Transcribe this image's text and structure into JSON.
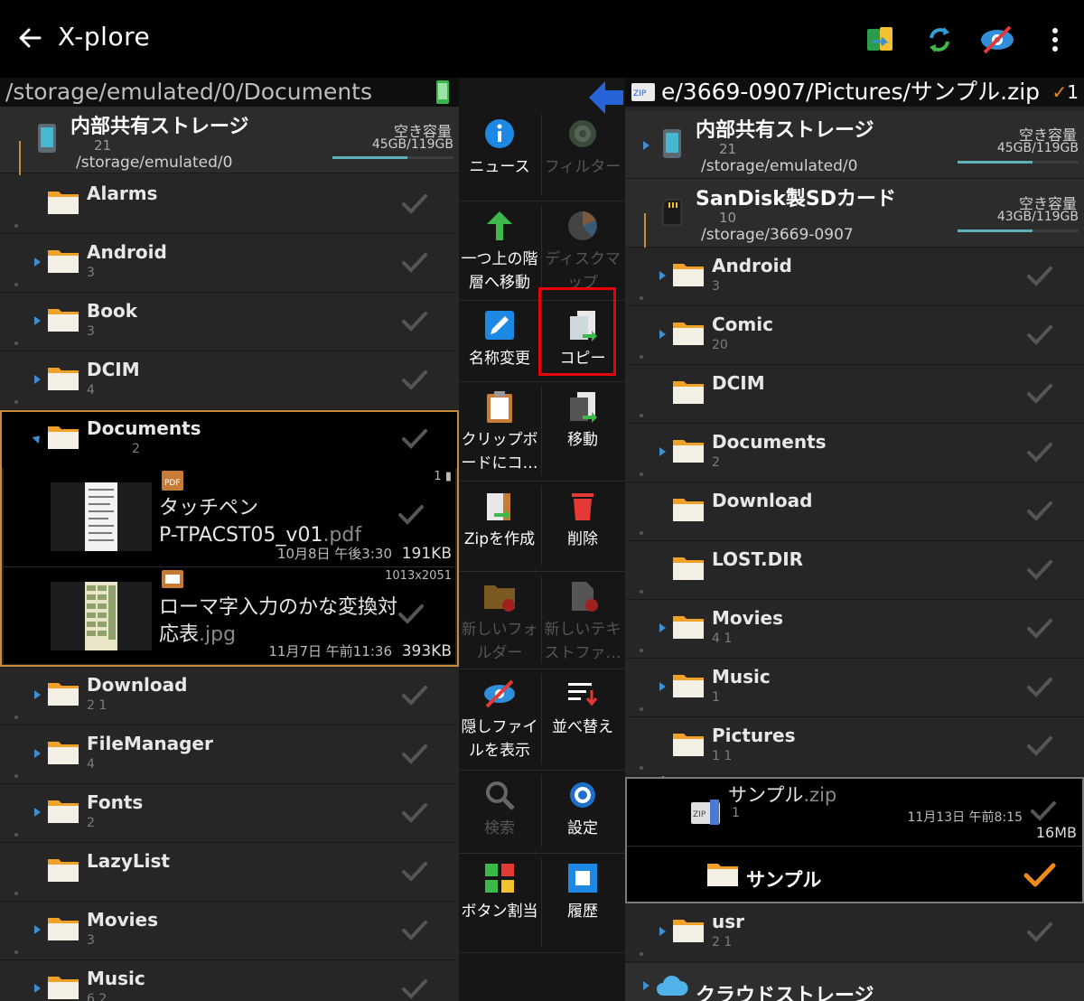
{
  "app": {
    "title": "X-plore"
  },
  "left": {
    "path": "/storage/emulated/0/Documents",
    "storage": {
      "title": "内部共有ストレージ",
      "count": "21",
      "path": "/storage/emulated/0",
      "free_label": "空き容量",
      "free_value": "45GB/119GB"
    },
    "folders_top": [
      {
        "name": "Alarms",
        "meta": ""
      },
      {
        "name": "Android",
        "meta": "3"
      },
      {
        "name": "Book",
        "meta": "3"
      },
      {
        "name": "DCIM",
        "meta": "4"
      }
    ],
    "documents": {
      "name": "Documents",
      "meta": "2"
    },
    "files": [
      {
        "line1": "タッチペン",
        "line2": "P-TPACST05_v01",
        "ext": ".pdf",
        "date": "10月8日 午後3:30",
        "size": "191KB",
        "tag": "1"
      },
      {
        "line1": "ローマ字入力のかな変換対",
        "line2": "応表",
        "ext": ".jpg",
        "date": "11月7日 午前11:36",
        "size": "393KB",
        "tag": "1013x2051"
      }
    ],
    "folders_bottom": [
      {
        "name": "Download",
        "meta": "2   1"
      },
      {
        "name": "FileManager",
        "meta": "4"
      },
      {
        "name": "Fonts",
        "meta": "2"
      },
      {
        "name": "LazyList",
        "meta": ""
      },
      {
        "name": "Movies",
        "meta": "3"
      },
      {
        "name": "Music",
        "meta": "6   2"
      }
    ]
  },
  "toolbar": [
    {
      "label": "ニュース",
      "icon": "info-icon",
      "enabled": true
    },
    {
      "label": "フィルター",
      "icon": "filter-icon",
      "enabled": false
    },
    {
      "label": "一つ上の階層へ移動",
      "icon": "up-arrow-icon",
      "enabled": true
    },
    {
      "label": "ディスクマップ",
      "icon": "disk-map-icon",
      "enabled": false
    },
    {
      "label": "名称変更",
      "icon": "rename-icon",
      "enabled": true
    },
    {
      "label": "コピー",
      "icon": "copy-icon",
      "enabled": true
    },
    {
      "label": "クリップボードにコ…",
      "icon": "clipboard-icon",
      "enabled": true
    },
    {
      "label": "移動",
      "icon": "move-icon",
      "enabled": true
    },
    {
      "label": "Zipを作成",
      "icon": "zip-create-icon",
      "enabled": true
    },
    {
      "label": "削除",
      "icon": "trash-icon",
      "enabled": true
    },
    {
      "label": "新しいフォルダー",
      "icon": "new-folder-icon",
      "enabled": false
    },
    {
      "label": "新しいテキストファ…",
      "icon": "new-text-icon",
      "enabled": false
    },
    {
      "label": "隠しファイルを表示",
      "icon": "hidden-eye-icon",
      "enabled": true
    },
    {
      "label": "並べ替え",
      "icon": "sort-icon",
      "enabled": true
    },
    {
      "label": "検索",
      "icon": "search-icon",
      "enabled": false
    },
    {
      "label": "設定",
      "icon": "gear-icon",
      "enabled": true
    },
    {
      "label": "ボタン割当",
      "icon": "button-assign-icon",
      "enabled": true
    },
    {
      "label": "履歴",
      "icon": "history-icon",
      "enabled": true
    }
  ],
  "right": {
    "path": "e/3669-0907/Pictures/サンプル.zip",
    "selected_count": "1",
    "storage1": {
      "title": "内部共有ストレージ",
      "count": "21",
      "path": "/storage/emulated/0",
      "free_label": "空き容量",
      "free_value": "45GB/119GB"
    },
    "storage2": {
      "title": "SanDisk製SDカード",
      "count": "10",
      "path": "/storage/3669-0907",
      "free_label": "空き容量",
      "free_value": "43GB/119GB"
    },
    "folders": [
      {
        "name": "Android",
        "meta": "3"
      },
      {
        "name": "Comic",
        "meta": "20"
      },
      {
        "name": "DCIM",
        "meta": ""
      },
      {
        "name": "Documents",
        "meta": "2"
      },
      {
        "name": "Download",
        "meta": ""
      },
      {
        "name": "LOST.DIR",
        "meta": ""
      },
      {
        "name": "Movies",
        "meta": "4   1"
      },
      {
        "name": "Music",
        "meta": "1"
      },
      {
        "name": "Pictures",
        "meta": "1   1"
      }
    ],
    "zip": {
      "name": "サンプル",
      "ext": ".zip",
      "meta": "1",
      "date": "11月13日 午前8:15",
      "size": "16MB"
    },
    "zip_child": {
      "name": "サンプル"
    },
    "usr": {
      "name": "usr",
      "meta": "2   1"
    },
    "cloud": {
      "name": "クラウドストレージ"
    }
  },
  "colors": {
    "accent": "#3d8fd1",
    "selection": "#f08a1c",
    "frame": "#c98a3e",
    "highlight": "#e8000b"
  }
}
